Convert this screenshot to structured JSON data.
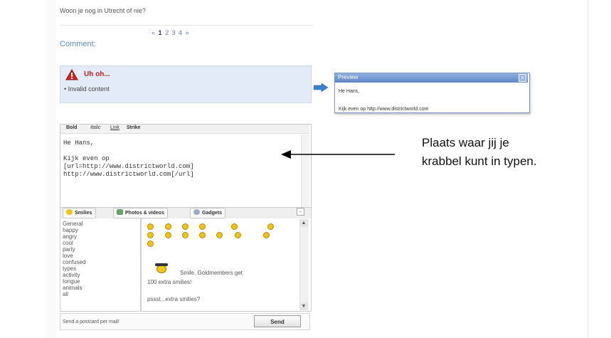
{
  "previous_post": {
    "text": "Woon je nog in Utrecht of nie?"
  },
  "pagination": {
    "prev": "«",
    "pages": [
      "1",
      "2",
      "3",
      "4"
    ],
    "current": "1",
    "next": "»"
  },
  "comment": {
    "label": "Comment:"
  },
  "error": {
    "title": "Uh oh...",
    "items": [
      "Invalid content"
    ]
  },
  "preview": {
    "title": "Preview",
    "close": "x",
    "line1": "He Hans,",
    "line2": "Kijk even op http://www.districtworld.com"
  },
  "editor": {
    "toolbar": [
      "Bold",
      "Italic",
      "Link",
      "Strike"
    ],
    "content": "He Hans,\n\nKijk even op\n[url=http://www.districtworld.com]\nhttp://www.districtworld.com[/url]"
  },
  "tabs": [
    {
      "label": "Smilies",
      "icon": "smiley-icon"
    },
    {
      "label": "Photos & videos",
      "icon": "photo-icon"
    },
    {
      "label": "Gadgets",
      "icon": "gadget-icon"
    }
  ],
  "categories": [
    "General",
    "happy",
    "angry",
    "cool",
    "party",
    "love",
    "confused",
    "types",
    "activity",
    "tongue",
    "animals",
    "all"
  ],
  "goldmember": {
    "line1": "Smile, Goldmembers get",
    "line2": "100 extra smilies!"
  },
  "psst": "pssst...extra smilies?",
  "footer": {
    "postcard": "Send a postcard per mail!",
    "send": "Send"
  },
  "annotation": {
    "text_line1": "Plaats waar jij je",
    "text_line2": "krabbel kunt in typen."
  },
  "colors": {
    "accent": "#5b8fbe",
    "error": "#c21f1f",
    "preview_header": "#6c91cf"
  }
}
